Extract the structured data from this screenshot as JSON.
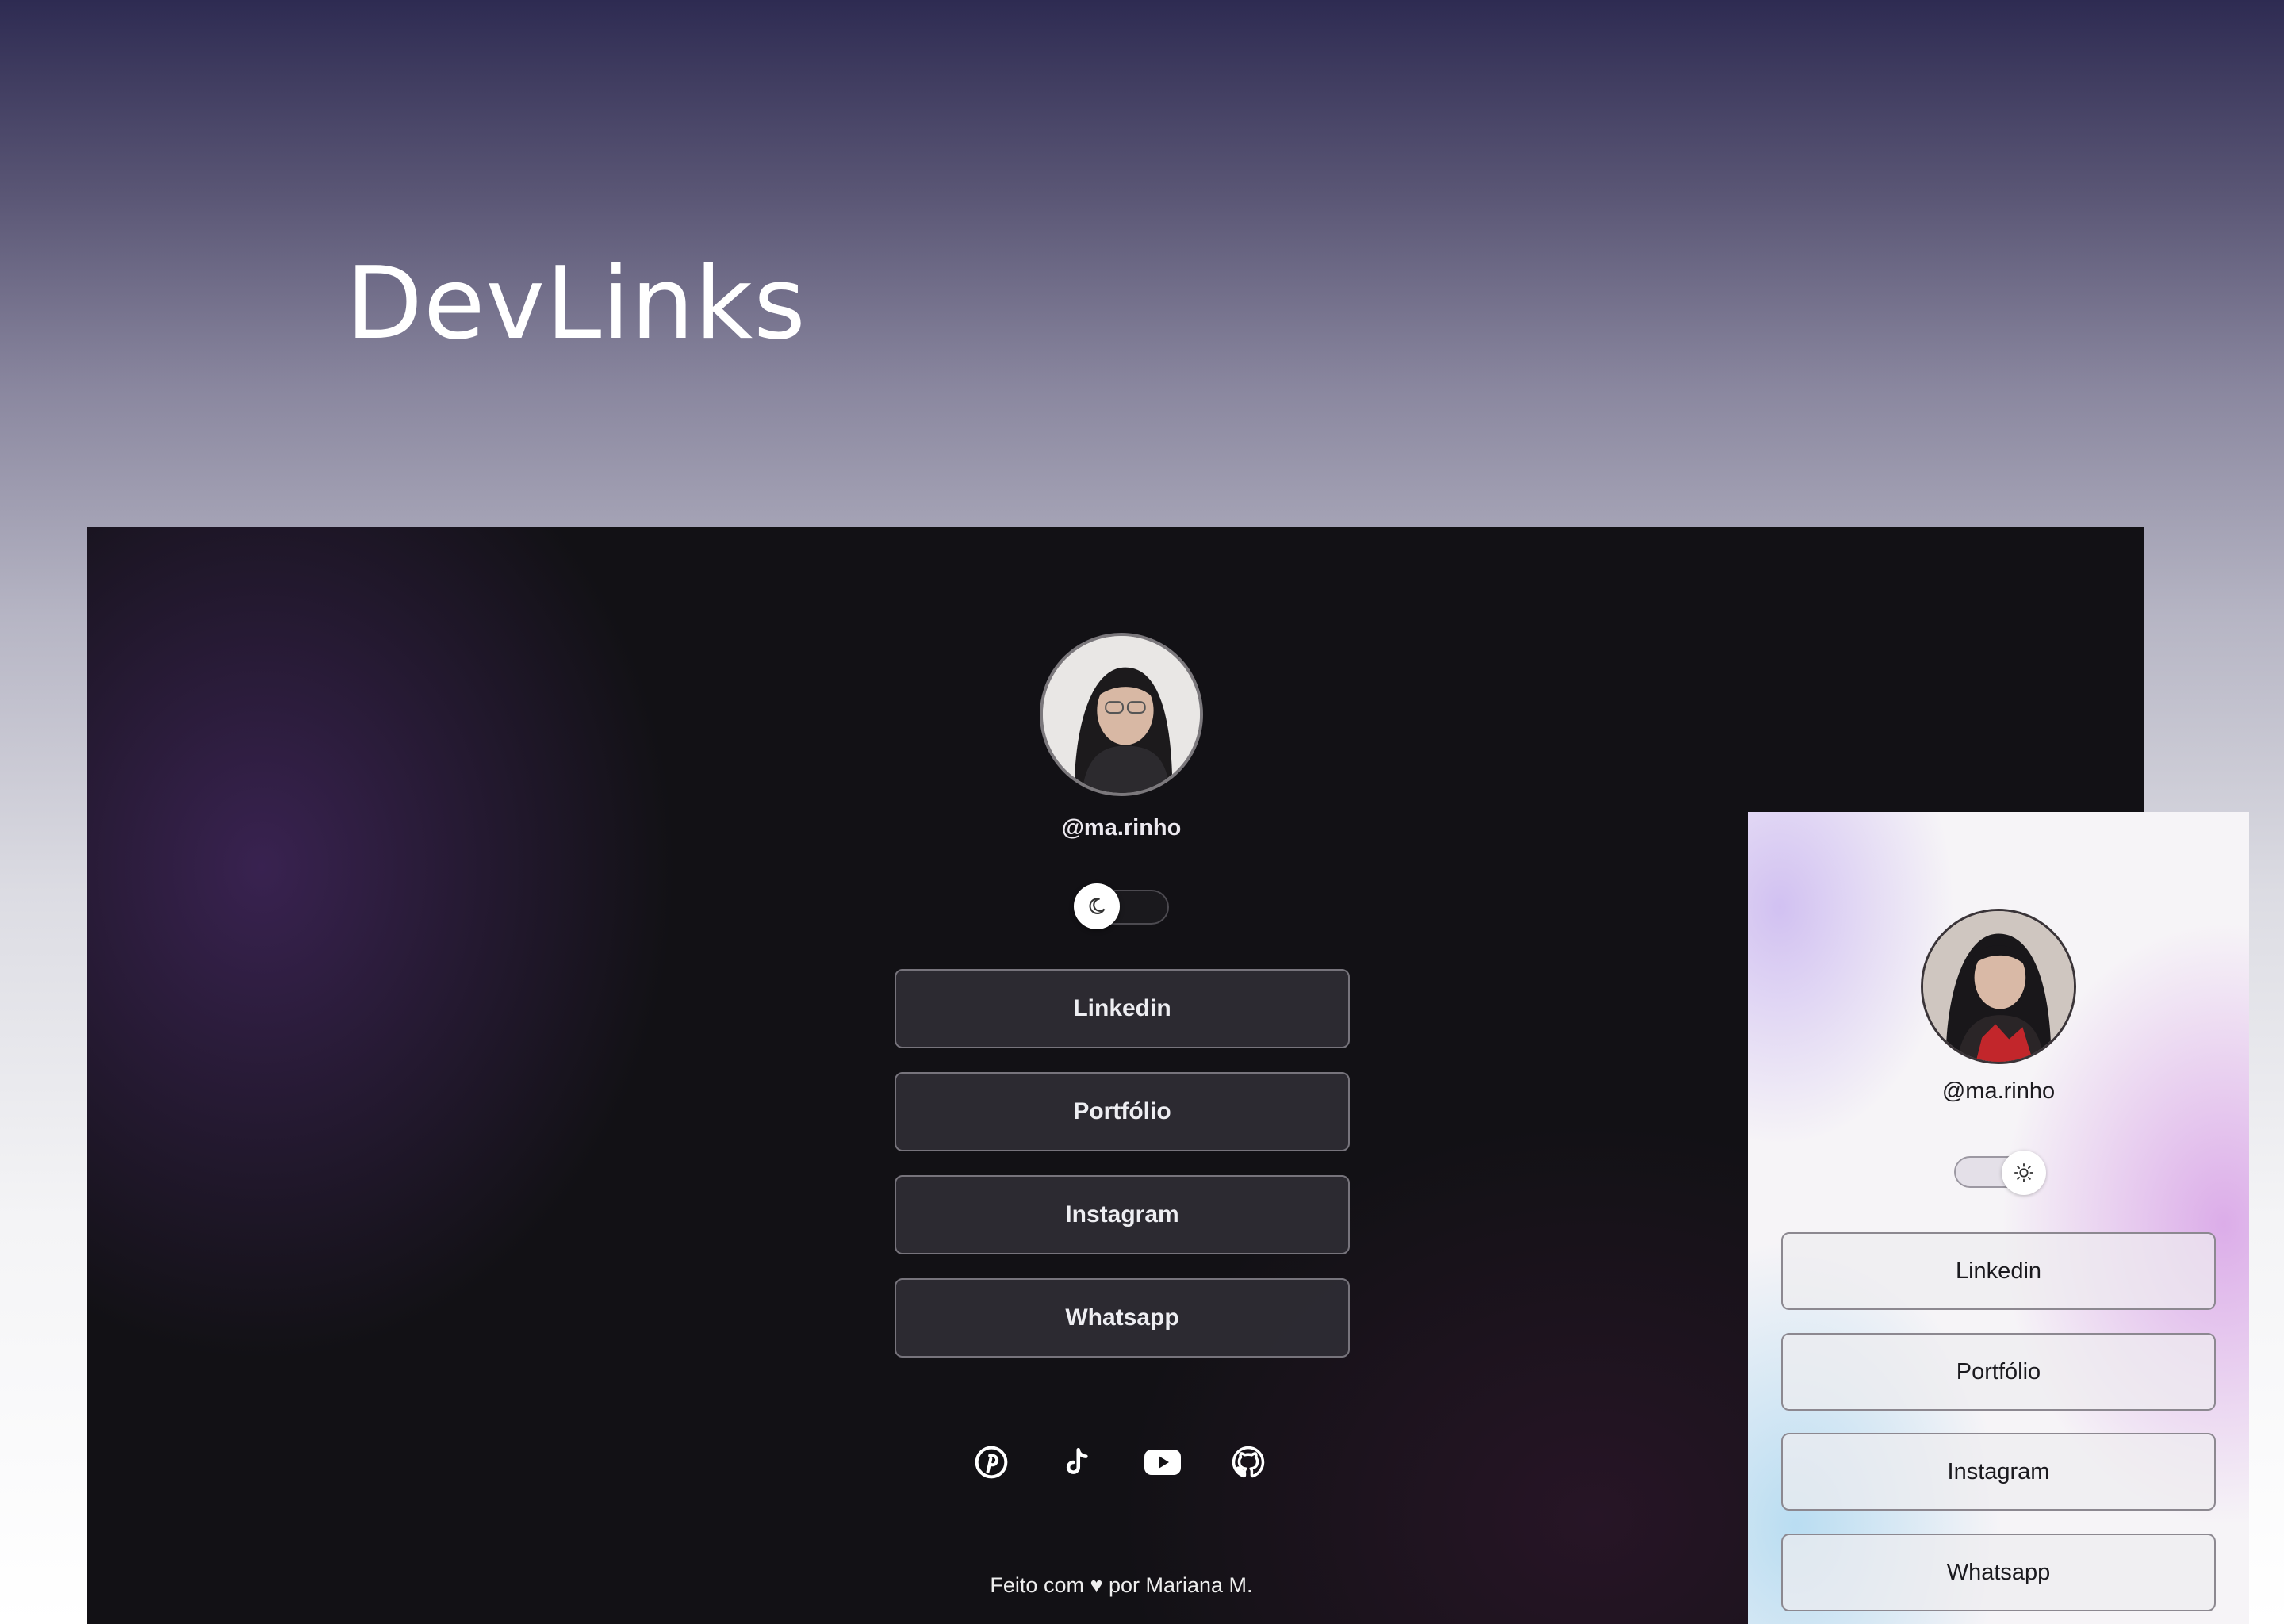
{
  "app_title": "DevLinks",
  "desktop": {
    "handle": "@ma.rinho",
    "theme_toggle": {
      "mode": "dark",
      "knob_icon": "moon-icon"
    },
    "links": [
      "Linkedin",
      "Portfólio",
      "Instagram",
      "Whatsapp"
    ],
    "socials": [
      "pinterest-icon",
      "tiktok-icon",
      "youtube-icon",
      "github-icon"
    ],
    "footer": "Feito com ♥ por Mariana M."
  },
  "mobile": {
    "handle": "@ma.rinho",
    "theme_toggle": {
      "mode": "light",
      "knob_icon": "sun-icon"
    },
    "links": [
      "Linkedin",
      "Portfólio",
      "Instagram",
      "Whatsapp"
    ]
  },
  "colors": {
    "dark_bg": "#121115",
    "dark_button": "#2f2d34",
    "light_button": "#eeecf0",
    "accent_purple": "#3d2a5c"
  }
}
